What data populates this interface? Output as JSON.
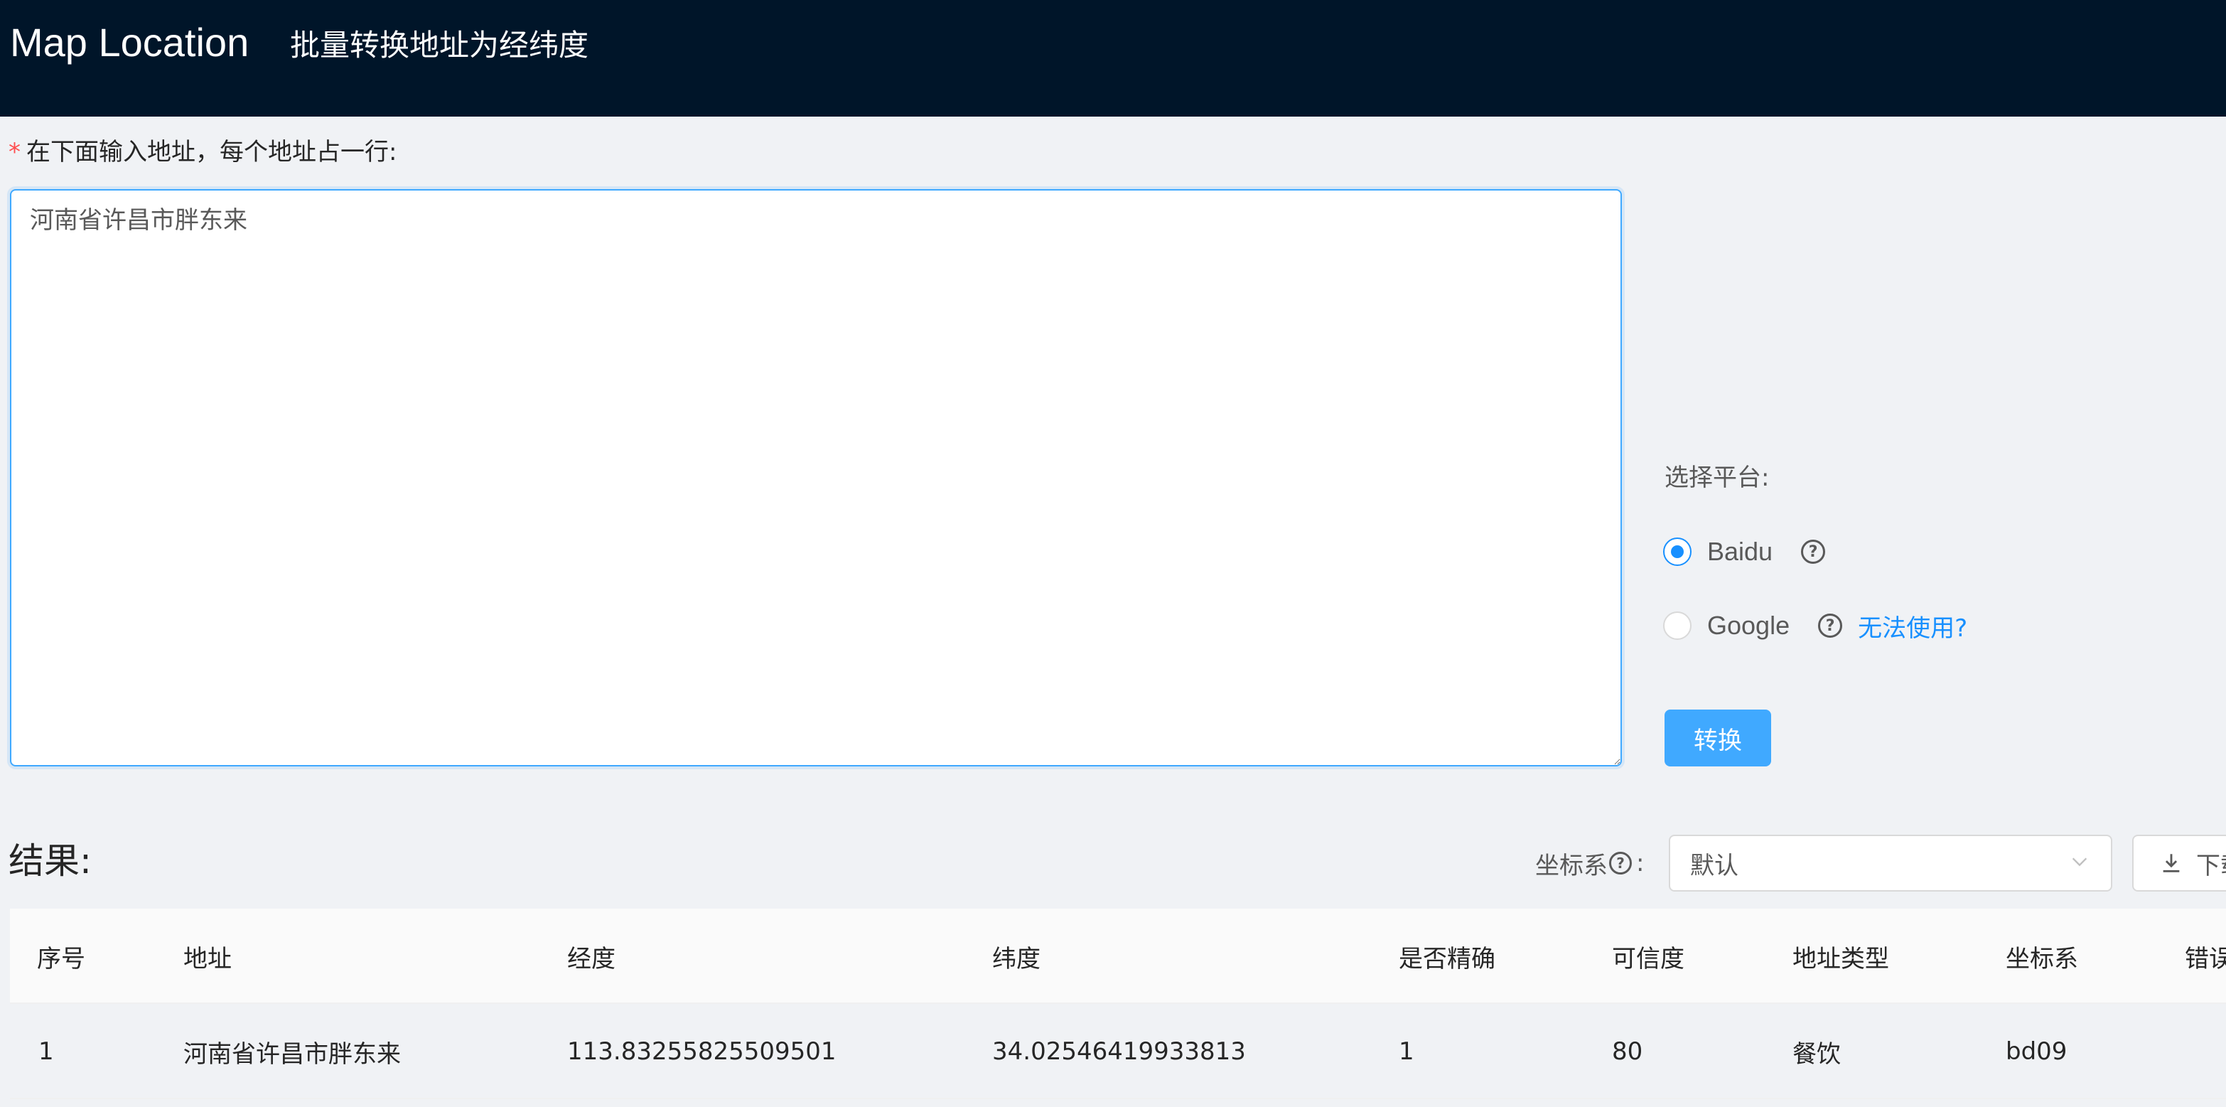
{
  "header": {
    "app_title": "Map Location",
    "subtitle": "批量转换地址为经纬度"
  },
  "input": {
    "required_mark": "*",
    "label": "在下面输入地址，每个地址占一行:",
    "value": "河南省许昌市胖东来"
  },
  "platform": {
    "label": "选择平台:",
    "options": [
      {
        "label": "Baidu",
        "checked": true
      },
      {
        "label": "Google",
        "checked": false
      }
    ],
    "help_link": "无法使用?",
    "convert_label": "转换"
  },
  "results": {
    "title": "结果:",
    "coord_label": "坐标系",
    "coord_suffix": ":",
    "coord_select_value": "默认",
    "download_label": "下载",
    "columns": [
      "序号",
      "地址",
      "经度",
      "纬度",
      "是否精确",
      "可信度",
      "地址类型",
      "坐标系",
      "错误"
    ],
    "rows": [
      [
        "1",
        "河南省许昌市胖东来",
        "113.83255825509501",
        "34.02546419933813",
        "1",
        "80",
        "餐饮",
        "bd09",
        ""
      ]
    ]
  },
  "colors": {
    "header_bg": "#001529",
    "primary": "#1890ff",
    "button_bg": "#40a9ff",
    "page_bg": "#f0f2f5"
  },
  "icons": {
    "help": "question-circle-icon",
    "download": "download-icon",
    "dropdown": "chevron-down-icon"
  }
}
